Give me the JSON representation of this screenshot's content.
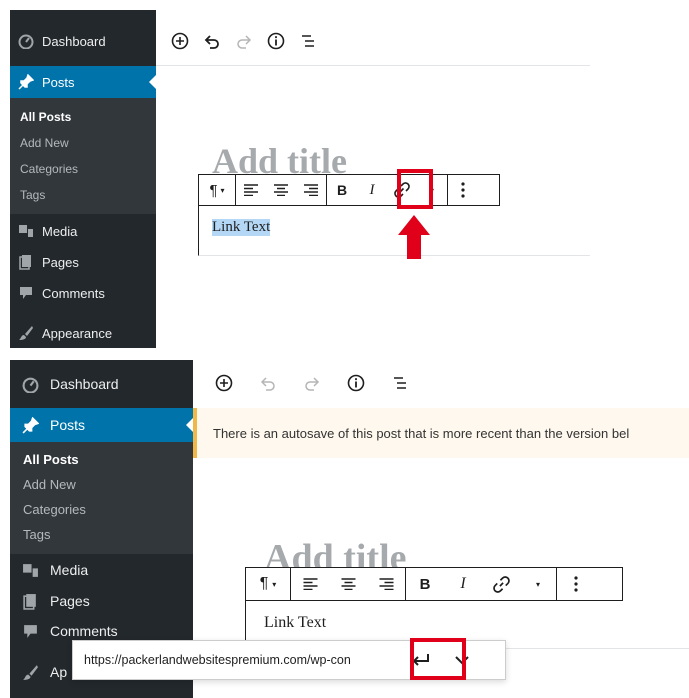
{
  "panel1": {
    "sidebar": {
      "dashboard": "Dashboard",
      "posts": "Posts",
      "submenu": [
        "All Posts",
        "Add New",
        "Categories",
        "Tags"
      ],
      "media": "Media",
      "pages": "Pages",
      "comments": "Comments",
      "appearance": "Appearance"
    },
    "title_placeholder": "Add title",
    "block_text": "Link Text"
  },
  "panel2": {
    "sidebar": {
      "dashboard": "Dashboard",
      "posts": "Posts",
      "submenu": [
        "All Posts",
        "Add New",
        "Categories",
        "Tags"
      ],
      "media": "Media",
      "pages": "Pages",
      "comments": "Comments",
      "appearance_partial": "Ap"
    },
    "notice": "There is an autosave of this post that is more recent than the version bel",
    "title_placeholder": "Add title",
    "block_text": "Link Text",
    "url_value": "https://packerlandwebsitespremium.com/wp-con"
  },
  "colors": {
    "sidebar_bg": "#23282d",
    "active_bg": "#0073aa",
    "highlight": "#e0001a",
    "notice_border": "#f0b849"
  }
}
